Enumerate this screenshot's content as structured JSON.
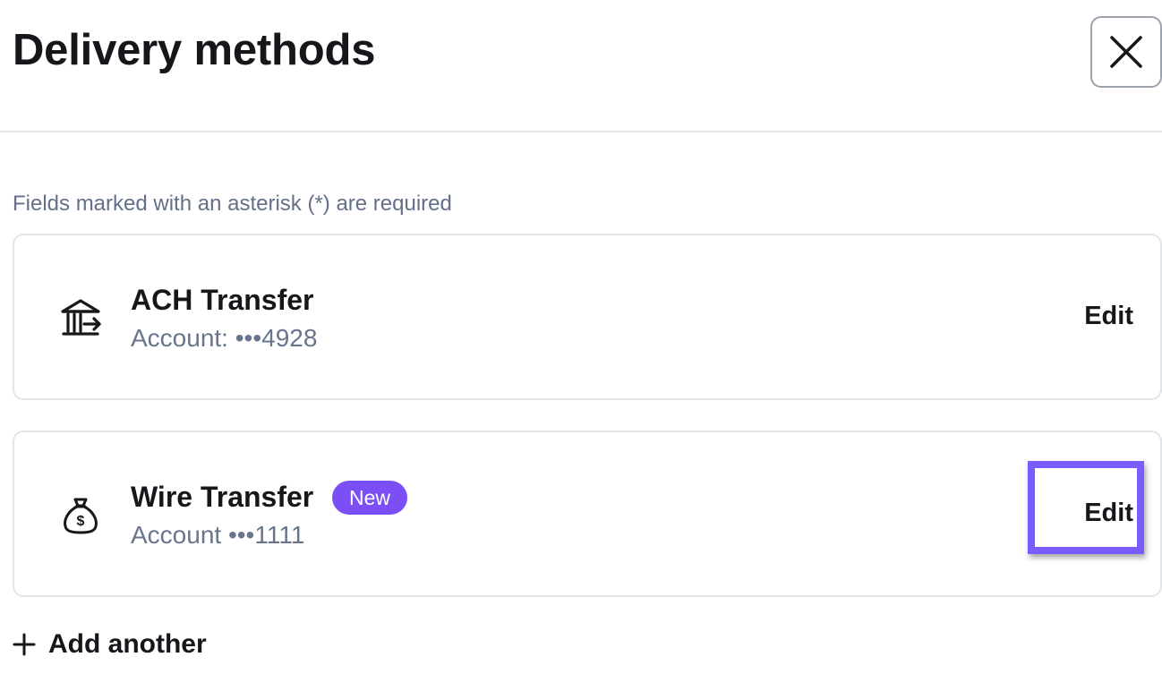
{
  "header": {
    "title": "Delivery methods",
    "close_icon": "close-icon"
  },
  "form": {
    "required_note": "Fields marked with an asterisk (*) are required"
  },
  "methods": [
    {
      "icon": "bank-transfer-icon",
      "title": "ACH Transfer",
      "account": "Account: •••4928",
      "edit_label": "Edit"
    },
    {
      "icon": "money-bag-icon",
      "title": "Wire Transfer",
      "badge": "New",
      "account": "Account •••1111",
      "edit_label": "Edit"
    }
  ],
  "actions": {
    "add_another_label": "Add another",
    "add_icon": "plus-icon"
  },
  "colors": {
    "accent": "#7b4ff5",
    "highlight": "#7a5cff",
    "muted_text": "#68758d",
    "border": "#e2e5ea"
  }
}
